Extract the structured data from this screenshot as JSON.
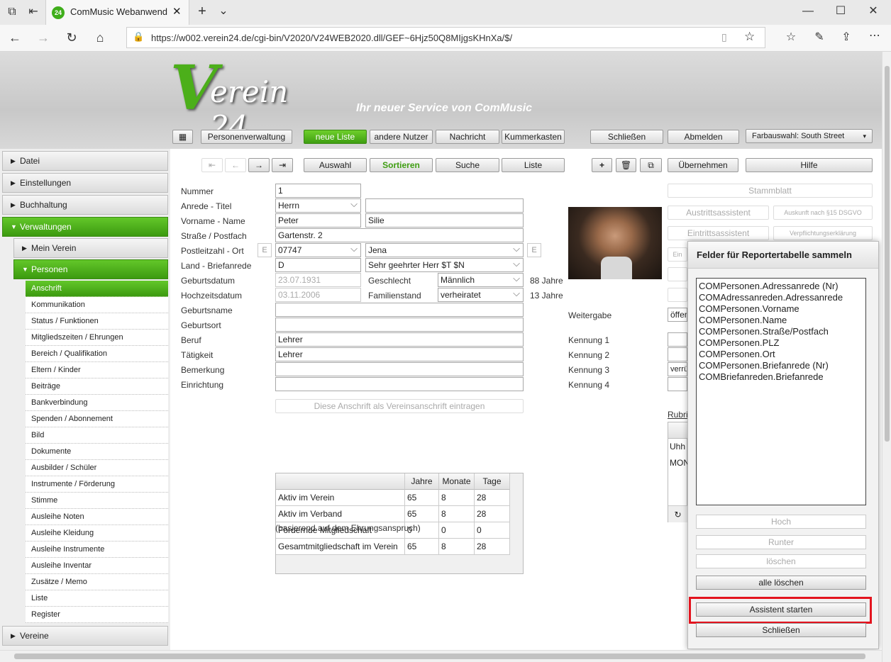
{
  "browser": {
    "tab_title": "ComMusic Webanwend",
    "url": "https://w002.verein24.de/cgi-bin/V2020/V24WEB2020.dll/GEF~6Hjz50Q8MIjgsKHnXa/$/"
  },
  "header": {
    "logo_text": "Verein 24",
    "tagline": "Ihr neuer Service von ComMusic",
    "nav": [
      "Personenverwaltung",
      "neue Liste",
      "andere Nutzer",
      "Nachricht",
      "Kummerkasten",
      "Schließen",
      "Abmelden"
    ],
    "color_select": "Farbauswahl: South Street"
  },
  "toolbar": {
    "auswahl": "Auswahl",
    "sortieren": "Sortieren",
    "suche": "Suche",
    "liste": "Liste",
    "uebernehmen": "Übernehmen",
    "hilfe": "Hilfe"
  },
  "sidebar": {
    "top": [
      "Datei",
      "Einstellungen",
      "Buchhaltung",
      "Verwaltungen"
    ],
    "sub": [
      "Mein Verein",
      "Personen"
    ],
    "leaves": [
      "Anschrift",
      "Kommunikation",
      "Status / Funktionen",
      "Mitgliedszeiten / Ehrungen",
      "Bereich / Qualifikation",
      "Eltern / Kinder",
      "Beiträge",
      "Bankverbindung",
      "Spenden / Abonnement",
      "Bild",
      "Dokumente",
      "Ausbilder / Schüler",
      "Instrumente / Förderung",
      "Stimme",
      "Ausleihe Noten",
      "Ausleihe Kleidung",
      "Ausleihe Instrumente",
      "Ausleihe Inventar",
      "Zusätze / Memo",
      "Liste",
      "Register"
    ],
    "bottom": "Vereine"
  },
  "form": {
    "labels": {
      "nummer": "Nummer",
      "anrede": "Anrede - Titel",
      "name": "Vorname - Name",
      "strasse": "Straße / Postfach",
      "plz": "Postleitzahl - Ort",
      "land": "Land - Briefanrede",
      "geburt": "Geburtsdatum",
      "hochzeit": "Hochzeitsdatum",
      "geburtsname": "Geburtsname",
      "geburtsort": "Geburtsort",
      "beruf": "Beruf",
      "taetigkeit": "Tätigkeit",
      "bemerkung": "Bemerkung",
      "einrichtung": "Einrichtung",
      "geschlecht": "Geschlecht",
      "familienstand": "Familienstand",
      "weitergabe": "Weitergabe",
      "kennung1": "Kennung 1",
      "kennung2": "Kennung 2",
      "kennung3": "Kennung 3",
      "kennung4": "Kennung 4",
      "rubrik": "Rubri"
    },
    "values": {
      "nummer": "1",
      "anrede": "Herrn",
      "vorname": "Peter",
      "name": "Silie",
      "strasse": "Gartenstr. 2",
      "plz": "07747",
      "ort": "Jena",
      "land": "D",
      "briefanrede": "Sehr geehrter Herr $T $N",
      "geburt": "23.07.1931",
      "hochzeit": "03.11.2006",
      "geschlecht": "Männlich",
      "familienstand": "verheiratet",
      "alter": "88 Jahre",
      "ehejahre": "13 Jahre",
      "beruf": "Lehrer",
      "taetigkeit": "Lehrer",
      "weitergabe": "öffen",
      "kennung3": "verrü"
    },
    "vereinsanschrift_btn": "Diese Anschrift als Vereinsanschrift eintragen",
    "e_label": "E"
  },
  "right_buttons": {
    "stammblatt": "Stammblatt",
    "austritt": "Austrittsassistent",
    "auskunft": "Auskunft nach §15 DSGVO",
    "eintritt": "Eintrittsassistent",
    "verpflichtung": "Verpflichtungserklärung",
    "ein": "Ein",
    "rubrik_rows": [
      "Uhh",
      "MON"
    ]
  },
  "ehrung_table": {
    "headers": [
      "",
      "Jahre",
      "Monate",
      "Tage"
    ],
    "rows": [
      [
        "Aktiv im Verein",
        "65",
        "8",
        "28"
      ],
      [
        "Aktiv im Verband",
        "65",
        "8",
        "28"
      ],
      [
        "Fördernde Mitgliedschaft",
        "0",
        "0",
        "0"
      ],
      [
        "Gesamtmitgliedschaft im Verein",
        "65",
        "8",
        "28"
      ]
    ],
    "note": "(basierend auf dem Ehrungsanspruch)"
  },
  "dialog": {
    "title": "Felder für Reportertabelle sammeln",
    "fields": [
      "COMPersonen.Adressanrede (Nr)",
      "COMAdressanreden.Adressanrede",
      "COMPersonen.Vorname",
      "COMPersonen.Name",
      "COMPersonen.Straße/Postfach",
      "COMPersonen.PLZ",
      "COMPersonen.Ort",
      "COMPersonen.Briefanrede (Nr)",
      "COMBriefanreden.Briefanrede"
    ],
    "buttons": {
      "hoch": "Hoch",
      "runter": "Runter",
      "loeschen": "löschen",
      "alle_loeschen": "alle löschen",
      "assistent": "Assistent starten",
      "schliessen": "Schließen"
    }
  },
  "colors": {
    "accent_green": "#4caf1a",
    "highlight_red": "#e3141e"
  }
}
